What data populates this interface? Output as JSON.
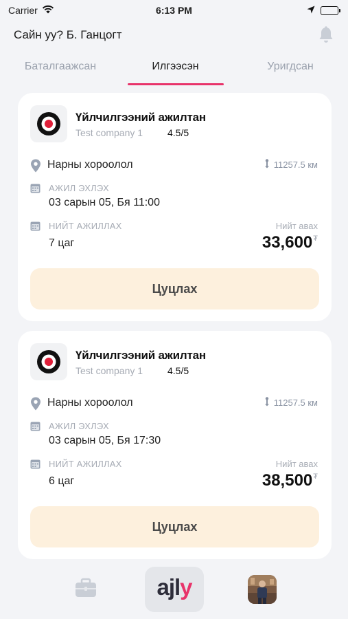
{
  "status_bar": {
    "carrier": "Carrier",
    "time": "6:13 PM"
  },
  "header": {
    "greeting": "Сайн уу? Б. Ганцогт"
  },
  "tabs": [
    {
      "label": "Баталгаажсан",
      "active": false
    },
    {
      "label": "Илгээсэн",
      "active": true
    },
    {
      "label": "Уригдсан",
      "active": false
    }
  ],
  "cards": [
    {
      "job_title": "Үйлчилгээний ажилтан",
      "company": "Test company 1",
      "rating": "4.5/5",
      "location": "Нарны хороолол",
      "distance": "11257.5 км",
      "start_label": "АЖИЛ ЭХЛЭХ",
      "start_value": "03 сарын 05, Бя 11:00",
      "total_label": "НИЙТ АЖИЛЛАХ",
      "total_value": "7 цаг",
      "earn_label": "Нийт авах",
      "earn_value": "33,600",
      "currency": "₮",
      "cancel_label": "Цуцлах"
    },
    {
      "job_title": "Үйлчилгээний ажилтан",
      "company": "Test company 1",
      "rating": "4.5/5",
      "location": "Нарны хороолол",
      "distance": "11257.5 км",
      "start_label": "АЖИЛ ЭХЛЭХ",
      "start_value": "03 сарын 05, Бя 17:30",
      "total_label": "НИЙТ АЖИЛЛАХ",
      "total_value": "6 цаг",
      "earn_label": "Нийт авах",
      "earn_value": "38,500",
      "currency": "₮",
      "cancel_label": "Цуцлах"
    }
  ],
  "bottom_nav": {
    "logo_text": "ajly"
  },
  "colors": {
    "accent": "#e8336a",
    "cancel_bg": "#fdf0dd",
    "muted": "#a6abb4",
    "background": "#f3f4f7"
  },
  "icons": [
    "wifi-icon",
    "location-arrow-icon",
    "battery-icon",
    "bell-icon",
    "company-logo-icon",
    "location-pin-icon",
    "distance-icon",
    "calendar-icon",
    "briefcase-icon",
    "ajly-logo",
    "avatar"
  ]
}
